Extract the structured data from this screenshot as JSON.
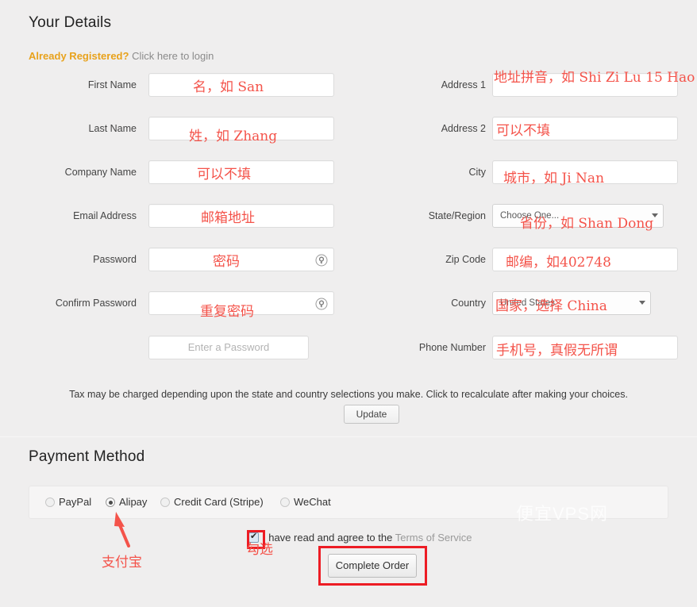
{
  "sections": {
    "details_title": "Your Details",
    "payment_title": "Payment Method"
  },
  "login": {
    "strong": "Already Registered?",
    "link": "Click here to login"
  },
  "left_fields": [
    {
      "label": "First Name",
      "value": "",
      "annotation": "名，如 San",
      "type": "text"
    },
    {
      "label": "Last Name",
      "value": "",
      "annotation": "姓，如 Zhang",
      "type": "text"
    },
    {
      "label": "Company Name",
      "value": "",
      "annotation": "可以不填",
      "type": "text"
    },
    {
      "label": "Email Address",
      "value": "",
      "annotation": "邮箱地址",
      "type": "text"
    },
    {
      "label": "Password",
      "value": "",
      "annotation": "密码",
      "type": "password"
    },
    {
      "label": "Confirm Password",
      "value": "",
      "annotation": "重复密码",
      "type": "password"
    },
    {
      "label": "",
      "placeholder": "Enter a Password",
      "annotation": "",
      "type": "placeholder"
    }
  ],
  "right_fields": [
    {
      "label": "Address 1",
      "value": "",
      "annotation": "地址拼音，如 Shi Zi Lu 15 Hao",
      "type": "text"
    },
    {
      "label": "Address 2",
      "value": "",
      "annotation": "可以不填",
      "type": "text"
    },
    {
      "label": "City",
      "value": "",
      "annotation": "城市，如 Ji Nan",
      "type": "text"
    },
    {
      "label": "State/Region",
      "value": "Choose One...",
      "annotation": "省份，如 Shan Dong",
      "type": "select"
    },
    {
      "label": "Zip Code",
      "value": "",
      "annotation": "邮编，如402748",
      "type": "text"
    },
    {
      "label": "Country",
      "value": "United States",
      "annotation": "国家，选择 China",
      "type": "select"
    },
    {
      "label": "Phone Number",
      "value": "",
      "annotation": "手机号，真假无所谓",
      "type": "text"
    }
  ],
  "tax": {
    "note": "Tax may be charged depending upon the state and country selections you make. Click to recalculate after making your choices.",
    "update_label": "Update"
  },
  "payment_options": [
    {
      "label": "PayPal",
      "selected": false
    },
    {
      "label": "Alipay",
      "selected": true
    },
    {
      "label": "Credit Card (Stripe)",
      "selected": false
    },
    {
      "label": "WeChat",
      "selected": false
    }
  ],
  "agree": {
    "text": "I have read and agree to the ",
    "tos_label": "Terms of Service",
    "checked": true
  },
  "complete_order_label": "Complete Order",
  "annotations": {
    "alipay": "支付宝",
    "checkbox": "勾选"
  },
  "watermark": "便宜VPS网",
  "colors": {
    "page_background": "#efeeee",
    "annotation_red": "#f4534a",
    "highlight_red": "#ed1c24",
    "login_amber": "#e8a21c",
    "muted_gray": "#9a9a9a"
  }
}
